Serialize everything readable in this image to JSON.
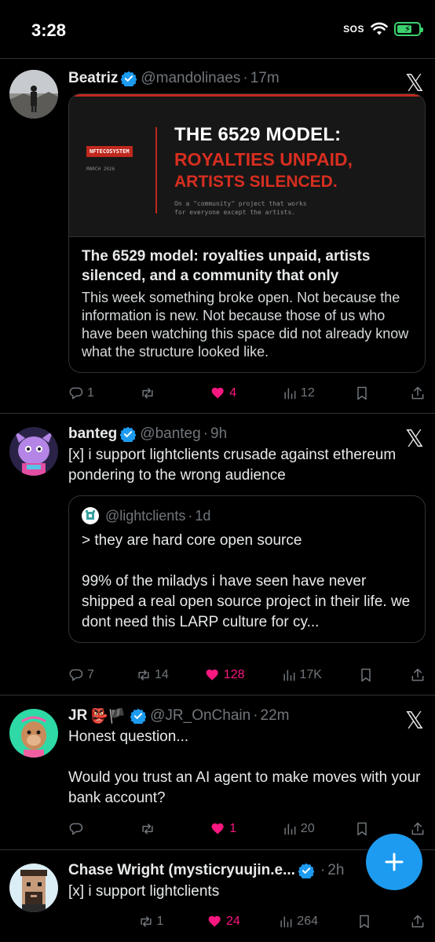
{
  "status_bar": {
    "time": "3:28",
    "sos": "SOS"
  },
  "tweets": [
    {
      "name": "Beatriz",
      "handle": "@mandolinaes",
      "time": "17m",
      "card": {
        "banner_tag": "NFTECOSYSTEM",
        "banner_date": "MARCH 2026",
        "banner_line1": "THE 6529 MODEL:",
        "banner_line2": "ROYALTIES UNPAID,",
        "banner_line3": "ARTISTS SILENCED.",
        "banner_subtitle": "On a \"community\" project that works\nfor everyone except the artists.",
        "title": "The 6529 model: royalties unpaid, artists silenced, and a community that only",
        "excerpt": "This week something broke open. Not because the information is new. Not because those of us who have been watching this space did not already know what the structure looked like."
      },
      "stats": {
        "replies": "1",
        "reposts": "",
        "likes": "4",
        "views": "12"
      }
    },
    {
      "name": "banteg",
      "handle": "@banteg",
      "time": "9h",
      "text": "[x] i support lightclients crusade against ethereum pondering to the wrong audience",
      "quote": {
        "handle": "@lightclients",
        "time": "1d",
        "text": "> they are hard core open source\n\n99% of the miladys i have seen have never shipped a real open source project in their life. we dont need this LARP culture for cy..."
      },
      "stats": {
        "replies": "7",
        "reposts": "14",
        "likes": "128",
        "views": "17K"
      }
    },
    {
      "name": "JR",
      "name_emoji": "👺🏴",
      "handle": "@JR_OnChain",
      "time": "22m",
      "text": "Honest question...\n\nWould you trust an AI agent to make moves with your bank account?",
      "stats": {
        "replies": "",
        "reposts": "",
        "likes": "1",
        "views": "20"
      }
    },
    {
      "name": "Chase Wright (mysticryuujin.e...",
      "handle": "",
      "time": "2h",
      "text": "[x] i support lightclients",
      "stats": {
        "replies": "",
        "reposts": "1",
        "likes": "24",
        "views": "264"
      }
    }
  ],
  "fab": {
    "label": "+"
  },
  "colors": {
    "background": "#000000",
    "accent": "#1d9bf0",
    "like": "#f91880",
    "muted": "#71767b",
    "verified": "#1d9bf0",
    "banner_red": "#d72e20"
  },
  "icons": [
    "reply-icon",
    "repost-icon",
    "like-icon",
    "views-icon",
    "bookmark-icon",
    "share-icon",
    "verified-badge-icon",
    "x-logo-icon",
    "compose-icon",
    "wifi-icon",
    "battery-icon"
  ]
}
